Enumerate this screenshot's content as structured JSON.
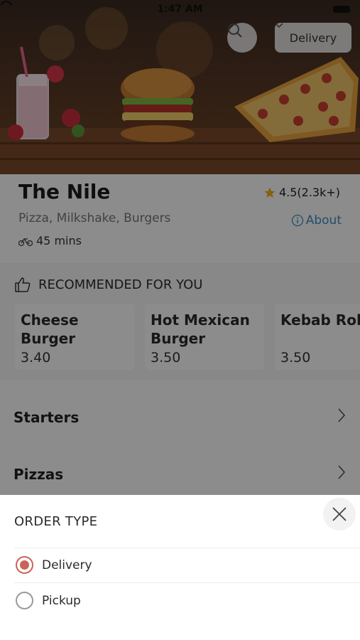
{
  "status_bar": {
    "time": "1:47 AM"
  },
  "header": {
    "search_icon": "search-icon",
    "order_type_selected": "Delivery"
  },
  "restaurant": {
    "name": "The Nile",
    "rating": "4.5(2.3k+)",
    "cuisine": "Pizza, Milkshake, Burgers",
    "about_label": "About",
    "eta": "45 mins"
  },
  "recommended": {
    "title": "RECOMMENDED FOR YOU",
    "items": [
      {
        "name": "Cheese Burger",
        "price": "3.40"
      },
      {
        "name": "Hot Mexican Burger",
        "price": "3.50"
      },
      {
        "name": "Kebab Roll",
        "price": "3.50"
      }
    ]
  },
  "categories": [
    {
      "label": "Starters"
    },
    {
      "label": "Pizzas"
    }
  ],
  "order_sheet": {
    "title": "ORDER TYPE",
    "options": [
      {
        "label": "Delivery",
        "selected": true
      },
      {
        "label": "Pickup",
        "selected": false
      }
    ]
  },
  "colors": {
    "accent": "#c9645a",
    "link": "#3d8fc4",
    "star": "#f2b01e"
  }
}
